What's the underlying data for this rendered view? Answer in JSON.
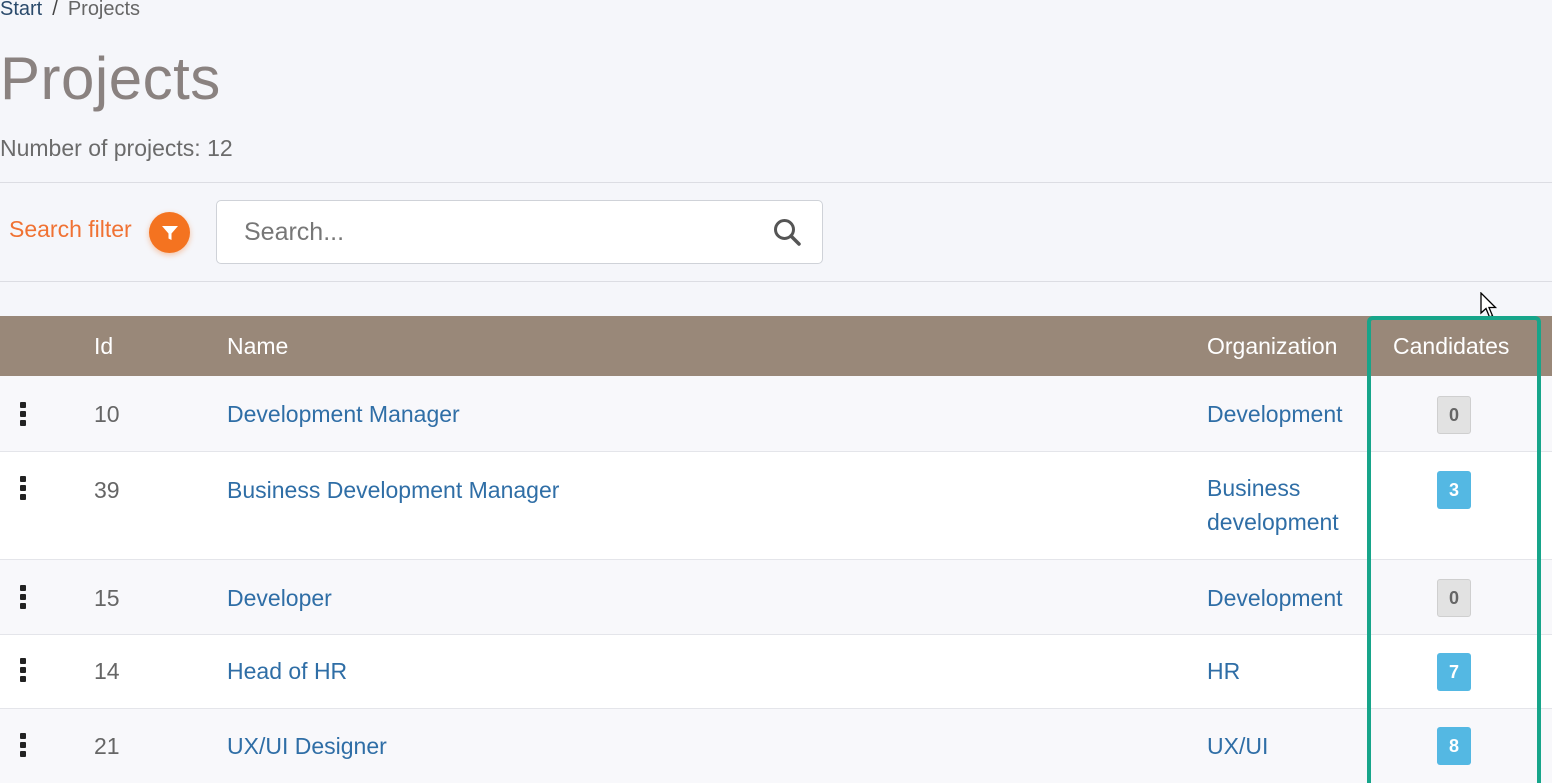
{
  "breadcrumb": {
    "home": "Start",
    "separator": "/",
    "current": "Projects"
  },
  "page": {
    "title": "Projects",
    "count_text": "Number of projects: 12"
  },
  "filter": {
    "label": "Search filter",
    "icon": "funnel-icon"
  },
  "search": {
    "placeholder": "Search...",
    "icon": "magnifier-icon"
  },
  "table": {
    "headers": {
      "id": "Id",
      "name": "Name",
      "organization": "Organization",
      "candidates": "Candidates"
    },
    "rows": [
      {
        "id": "10",
        "name": "Development Manager",
        "organization": "Development",
        "candidates": "0"
      },
      {
        "id": "39",
        "name": "Business Development Manager",
        "organization": "Business development",
        "candidates": "3"
      },
      {
        "id": "15",
        "name": "Developer",
        "organization": "Development",
        "candidates": "0"
      },
      {
        "id": "14",
        "name": "Head of HR",
        "organization": "HR",
        "candidates": "7"
      },
      {
        "id": "21",
        "name": "UX/UI Designer",
        "organization": "UX/UI",
        "candidates": "8"
      }
    ]
  },
  "colors": {
    "header_bg": "#998879",
    "link": "#2f6ea6",
    "filter_accent": "#f47320",
    "badge_positive": "#54b8e3",
    "badge_zero": "#e2e2e2",
    "highlight": "#17a58a"
  }
}
